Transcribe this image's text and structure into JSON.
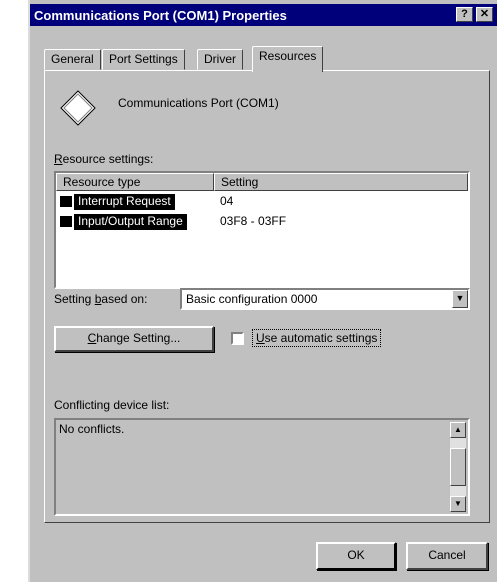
{
  "window": {
    "title": "Communications Port (COM1) Properties",
    "help_button": "?",
    "close_button": "✕"
  },
  "tabs": [
    {
      "label": "General",
      "active": false
    },
    {
      "label": "Port Settings",
      "active": false
    },
    {
      "label": "Driver",
      "active": false
    },
    {
      "label": "Resources",
      "active": true
    }
  ],
  "device": {
    "name": "Communications Port (COM1)",
    "icon": "port-icon"
  },
  "resource_settings": {
    "label_accel": "R",
    "label_rest": "esource settings:",
    "columns": [
      "Resource type",
      "Setting"
    ],
    "rows": [
      {
        "type": "Interrupt Request",
        "setting": "04"
      },
      {
        "type": "Input/Output Range",
        "setting": "03F8 - 03FF"
      }
    ]
  },
  "setting_based_on": {
    "label_pre": "Setting ",
    "label_accel": "b",
    "label_post": "ased on:",
    "value": "Basic configuration 0000"
  },
  "change_setting_button": {
    "accel": "C",
    "rest": "hange Setting..."
  },
  "automatic_settings": {
    "checked": false,
    "accel": "U",
    "rest": "se automatic settings"
  },
  "conflict_list": {
    "label": "Conflicting device list:",
    "text": "No conflicts."
  },
  "footer": {
    "ok_label": "OK",
    "cancel_label": "Cancel"
  },
  "colors": {
    "titlebar": "#00007b",
    "face": "#c0c0c0",
    "selection": "#000000"
  }
}
